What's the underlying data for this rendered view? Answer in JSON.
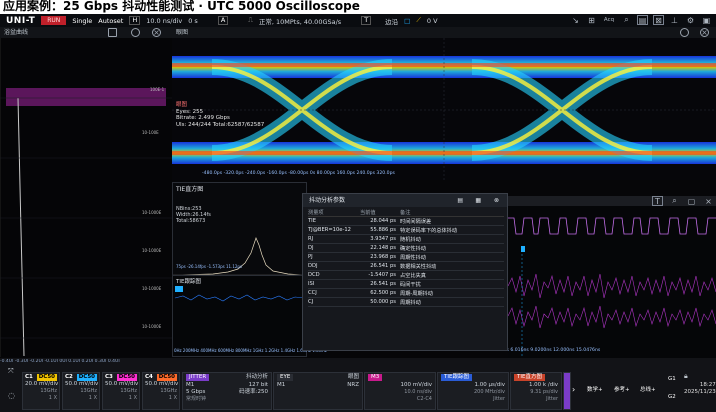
{
  "header": {
    "title": "应用案例：25 Gbps 抖动性能测试 · UTC 5000 Oscilloscope"
  },
  "topbar": {
    "logo": "UNI-T",
    "run_label": "RUN",
    "single_label": "Single",
    "autoset_label": "Autoset",
    "h_label": "H",
    "timebase": "10.0 ns/div",
    "delay": "0 s",
    "a_label": "A",
    "acq_status": "正常, 10MPts, 40.00GSa/s",
    "trigger_t": "T",
    "trigger_mode": "边沿",
    "trigger_level": "0 V",
    "acq_label": "Acq",
    "icons": [
      "cursor-icon",
      "grid-icon",
      "acq-icon",
      "zoom-icon",
      "save-icon",
      "measure-icon",
      "utility-icon",
      "settings-icon",
      "display-icon"
    ]
  },
  "left_panel": {
    "title": "浴盆曲线",
    "y_ticks": [
      "100E-1",
      "10-100E",
      "10-1000E",
      "10-1000E",
      "10-1000E",
      "10-1000E"
    ],
    "x_axis": "-0.4UI -0.3UI -0.2UI -0.1UI 0UI 0.1UI 0.2UI 0.3UI 0.4UI"
  },
  "eye_panel": {
    "title": "眼图",
    "eyes": "Eyes: 255",
    "bitrate": "Bitrate: 2.499 Gbps",
    "uis": "UIs: 244/244  Total:62587/62587",
    "axis": "-480.0ps   -320.0ps   -240.0ps   -160.0ps   -80.00ps   0s   80.00ps   160.0ps   240.0ps   320.0ps",
    "label": "眼图"
  },
  "tie_histogram": {
    "title": "TIE直方图",
    "stats": [
      "NBins:253",
      "Width:26.14fs",
      "Total:58673"
    ],
    "x_axis": "75ps   -26.14fps   -1.573ps   11.12ps"
  },
  "tie_trend": {
    "title": "TIE跟踪图",
    "axis": "0Hz  200MHz  400MHz  600MHz  800MHz  1GHz  1.2GHz  1.4GHz  1.6GHz  1.8GHz"
  },
  "dialog": {
    "title": "抖动分析参数",
    "columns": [
      "测量项",
      "当前值",
      "备注"
    ],
    "rows": [
      [
        "TIE",
        "28.044 ps",
        "时间间隔误差"
      ],
      [
        "TJ@BER=10e-12",
        "55.886 ps",
        "特定误码率下的总体抖动"
      ],
      [
        "RJ",
        "3.9347 ps",
        "随机抖动"
      ],
      [
        "DJ",
        "22.148 ps",
        "确定性抖动"
      ],
      [
        "PJ",
        "23.968 ps",
        "周期性抖动"
      ],
      [
        "DDJ",
        "26.541 ps",
        "数据相关性抖动"
      ],
      [
        "DCD",
        "-1.5407 ps",
        "占空比失真"
      ],
      [
        "ISI",
        "26.541 ps",
        "码间干扰"
      ],
      [
        "CCJ",
        "62.500 ps",
        "周期-周期抖动"
      ],
      [
        "CJ",
        "50.000 ps",
        "周期抖动"
      ]
    ]
  },
  "right_waves": {
    "axis": "-12.00079ns  -9.02079ns  -6.0161ns  -3.0000ns  0s  3.0000ns  6.016ns  9.0200ns  12.000ns  15.0476ns"
  },
  "channels": [
    {
      "name": "C1",
      "coupling": "DC50",
      "scale": "20.0 mV/div",
      "bw": "13GHz",
      "probe": "1 X",
      "color": "#f2c400"
    },
    {
      "name": "C2",
      "coupling": "DC50",
      "scale": "50.0 mV/div",
      "bw": "13GHz",
      "probe": "1 X",
      "color": "#1fb0ff"
    },
    {
      "name": "C3",
      "coupling": "DC50",
      "scale": "50.0 mV/div",
      "bw": "13GHz",
      "probe": "1 X",
      "color": "#ff2fd2"
    },
    {
      "name": "C4",
      "coupling": "DC50",
      "scale": "50.0 mV/div",
      "bw": "13GHz",
      "probe": "1 X",
      "color": "#ff6a2a"
    }
  ],
  "math": [
    {
      "tag": "JITTER",
      "right": "抖动分析",
      "l1": "M1",
      "r1": "127 bit",
      "l2": "5 Gbps",
      "r2": "码速率:250",
      "l3": "常规时钟",
      "r3": "",
      "color": "#7a3cc8"
    },
    {
      "tag": "EYE",
      "right": "眼图",
      "l1": "M1",
      "r1": "NRZ",
      "l2": "",
      "r2": "",
      "l3": "",
      "r3": "",
      "color": "#1f1f24"
    },
    {
      "tag": "M3",
      "right": "",
      "l1": "100 mV/div",
      "r1": "",
      "l2": "10.0 ns/div",
      "r2": "",
      "l3": "C2-C4",
      "r3": "",
      "color": "#c81a8c"
    },
    {
      "tag": "TIE跟踪图",
      "right": "",
      "l1": "1.00 µs/div",
      "r1": "",
      "l2": "200 MHz/div",
      "r2": "",
      "l3": "Jitter",
      "r3": "",
      "color": "#2a5cd6"
    },
    {
      "tag": "TIE直方图",
      "right": "",
      "l1": "1.00 k /div",
      "r1": "",
      "l2": "9.31 ps/div",
      "r2": "",
      "l3": "Jitter",
      "r3": "",
      "color": "#c8432a"
    }
  ],
  "bottom_buttons": {
    "m5": "M5",
    "math": "数学+",
    "ref": "参考+",
    "bus": "总线+",
    "g1": "G1",
    "g2": "G2"
  },
  "status": {
    "time": "18:27",
    "date": "2025/11/23"
  }
}
